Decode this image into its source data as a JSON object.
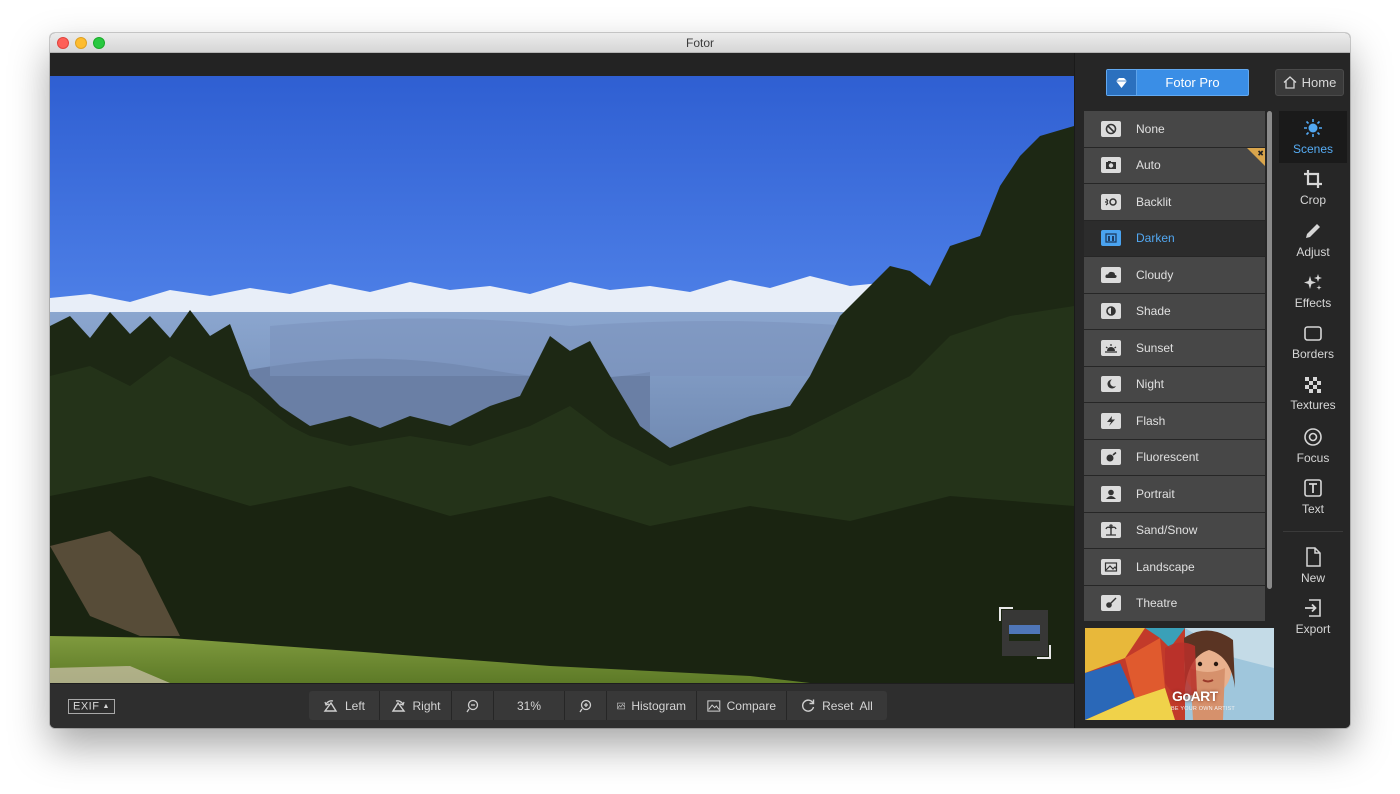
{
  "window": {
    "title": "Fotor"
  },
  "header": {
    "pro_label": "Fotor Pro",
    "home_label": "Home"
  },
  "scenes": [
    {
      "label": "None",
      "icon": "none-icon"
    },
    {
      "label": "Auto",
      "icon": "camera-icon",
      "badge": "new"
    },
    {
      "label": "Backlit",
      "icon": "backlit-icon"
    },
    {
      "label": "Darken",
      "icon": "darken-icon",
      "active": true
    },
    {
      "label": "Cloudy",
      "icon": "cloud-icon"
    },
    {
      "label": "Shade",
      "icon": "shade-icon"
    },
    {
      "label": "Sunset",
      "icon": "sunset-icon"
    },
    {
      "label": "Night",
      "icon": "moon-icon"
    },
    {
      "label": "Flash",
      "icon": "flash-icon"
    },
    {
      "label": "Fluorescent",
      "icon": "fluorescent-icon"
    },
    {
      "label": "Portrait",
      "icon": "portrait-icon"
    },
    {
      "label": "Sand/Snow",
      "icon": "palm-icon"
    },
    {
      "label": "Landscape",
      "icon": "landscape-icon"
    },
    {
      "label": "Theatre",
      "icon": "guitar-icon"
    }
  ],
  "tools": [
    {
      "label": "Scenes",
      "icon": "scenes-sun-icon",
      "active": true
    },
    {
      "label": "Crop",
      "icon": "crop-icon"
    },
    {
      "label": "Adjust",
      "icon": "pencil-icon"
    },
    {
      "label": "Effects",
      "icon": "sparkles-icon"
    },
    {
      "label": "Borders",
      "icon": "borders-icon"
    },
    {
      "label": "Textures",
      "icon": "checker-icon"
    },
    {
      "label": "Focus",
      "icon": "focus-icon"
    },
    {
      "label": "Text",
      "icon": "text-icon"
    }
  ],
  "file_tools": [
    {
      "label": "New",
      "icon": "new-file-icon"
    },
    {
      "label": "Export",
      "icon": "export-icon"
    }
  ],
  "bottombar": {
    "exif_label": "EXIF",
    "rotate_left_label": "Left",
    "rotate_right_label": "Right",
    "zoom_value": "31%",
    "histogram_label": "Histogram",
    "compare_label": "Compare",
    "reset_label": "Reset  All"
  },
  "ad": {
    "brand_go": "Go",
    "brand_art": "ART",
    "tagline": "BE YOUR OWN ARTIST"
  },
  "colors": {
    "accent": "#3a8ee6",
    "active_text": "#52a8f2",
    "badge": "#d9a54c",
    "panel": "#262626"
  }
}
